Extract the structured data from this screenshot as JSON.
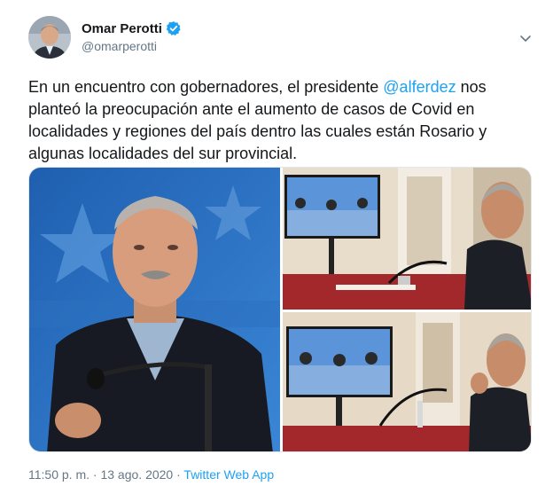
{
  "author": {
    "name": "Omar Perotti",
    "handle": "@omarperotti"
  },
  "tweet": {
    "text_before": "En un encuentro con gobernadores, el presidente ",
    "mention": "@alferdez",
    "text_after": " nos planteó la preocupación ante el aumento de casos de Covid en localidades y regiones del país dentro las cuales están Rosario y algunas localidades del sur provincial."
  },
  "footer": {
    "time": "11:50 p. m.",
    "separator": " · ",
    "date": "13 ago. 2020",
    "source": "Twitter Web App"
  },
  "colors": {
    "link": "#1da1f2",
    "muted": "#657786",
    "text": "#14171a"
  },
  "icons": {
    "verified": "verified-badge-icon",
    "caret": "chevron-down-icon"
  }
}
